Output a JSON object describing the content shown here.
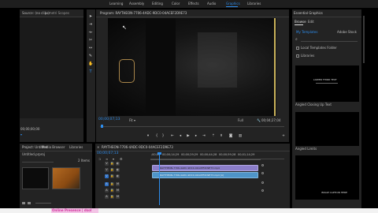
{
  "workspaces": [
    "Learning",
    "Assembly",
    "Editing",
    "Color",
    "Effects",
    "Audio",
    "Graphics",
    "Libraries"
  ],
  "active_workspace": "Graphics",
  "source_panel": {
    "tab_1": "Source: (no clips)",
    "tab_2": "Lumetri Scopes",
    "timecode": "00;00;00;00"
  },
  "program": {
    "title": "Program: RAYTHEON-7706-4ADC-9DC0-04ACEF2D9E73",
    "timecode_in": "00;00;07;13",
    "fit": "Fit",
    "full": "Full",
    "timecode_out": "00;04;27;04"
  },
  "essential_graphics": {
    "title": "Essential Graphics",
    "tab_browse": "Browse",
    "tab_edit": "Edit",
    "dropdown": "My Templates",
    "dropdown_right": "Adobe Stock",
    "check_local": "Local Templates Folder",
    "check_libraries": "Libraries",
    "template_1_caption": "Angled Closing Up Text",
    "template_2_caption": "Angled Limits",
    "thumb_text_1": "LOWER THIRD TEXT",
    "thumb_text_2": "IMAGE CAPTION HERE"
  },
  "project": {
    "tab_1": "Project: Untitled",
    "tab_2": "Media Browser",
    "tab_3": "Libraries",
    "item_name": "Untitled.prproj",
    "count": "2 Items"
  },
  "timeline": {
    "title": "RAYTHEON-7706-4ADC-9DC0-04ACEF2D9E73",
    "timecode": "00;00;07;13",
    "ruler": [
      ";00;00",
      "00;00;14;29",
      "00;00;29;29",
      "00;00;44;28",
      "00;00;59;28",
      "00;01;14;29"
    ],
    "video_clip": "RAYTHEON-7706-4ADC-9DC0-04ACEF2D9E73.mp4",
    "audio_clip": "RAYTHEON-7706-4ADC-9DC0-04ACEF2D9E73.mp4 [A]"
  },
  "bottom_banner": "Online Presence | dsol"
}
